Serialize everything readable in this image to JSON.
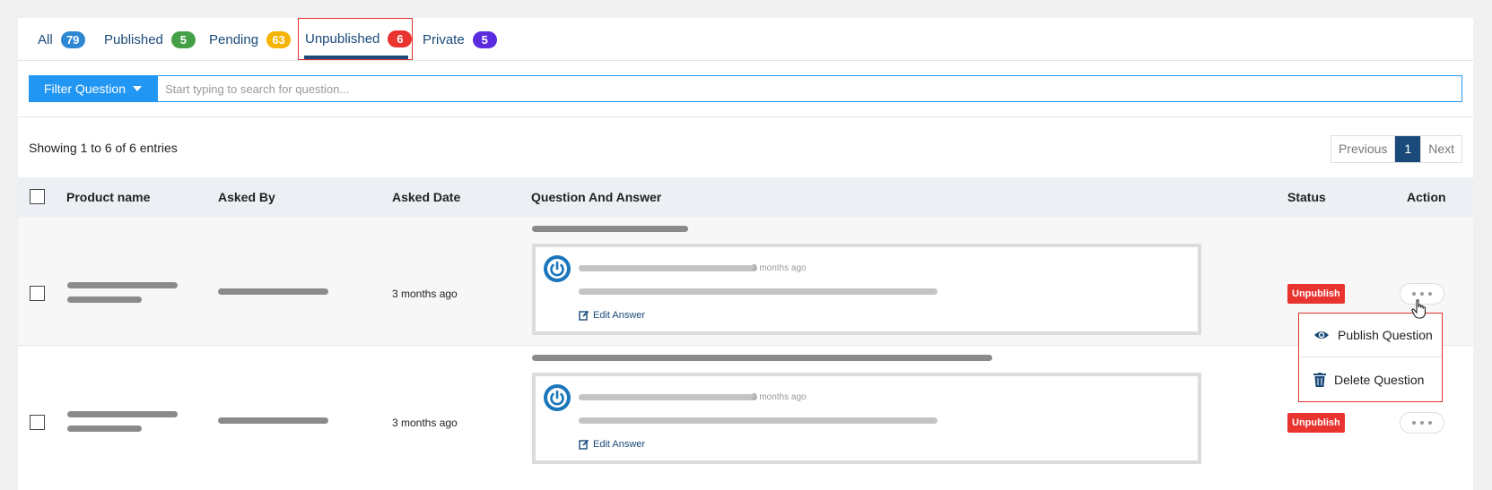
{
  "tabs": [
    {
      "label": "All",
      "count": "79",
      "color": "#2d87d3"
    },
    {
      "label": "Published",
      "count": "5",
      "color": "#43a047"
    },
    {
      "label": "Pending",
      "count": "63",
      "color": "#f5b400"
    },
    {
      "label": "Unpublished",
      "count": "6",
      "color": "#e8332e",
      "active": true
    },
    {
      "label": "Private",
      "count": "5",
      "color": "#5b2be0"
    }
  ],
  "filter": {
    "button_label": "Filter Question",
    "placeholder": "Start typing to search for question..."
  },
  "entries_text": "Showing 1 to 6 of 6 entries",
  "pagination": {
    "previous": "Previous",
    "current": "1",
    "next": "Next"
  },
  "table": {
    "headers": {
      "product": "Product name",
      "asked_by": "Asked By",
      "date": "Asked Date",
      "qa": "Question And Answer",
      "status": "Status",
      "action": "Action"
    },
    "rows": [
      {
        "date": "3 months ago",
        "answer_time": "3 months ago",
        "edit_label": "Edit Answer",
        "status": "Unpublish"
      },
      {
        "date": "3 months ago",
        "answer_time": "3 months ago",
        "edit_label": "Edit Answer",
        "status": "Unpublish"
      }
    ]
  },
  "action_menu": {
    "publish": "Publish Question",
    "delete": "Delete Question"
  },
  "icons": {
    "avatar": "power-icon",
    "edit": "edit-icon",
    "publish": "eye-icon",
    "delete": "trash-icon",
    "more": "ellipsis-icon"
  }
}
